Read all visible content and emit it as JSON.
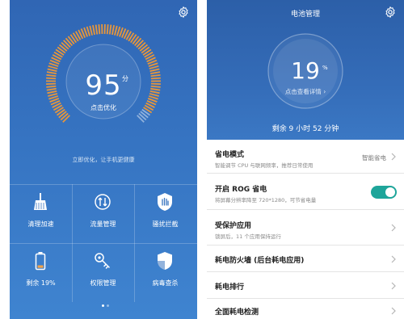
{
  "colors": {
    "left_bg_top": "#3066b4",
    "gauge_orange": "#e8963a",
    "right_bg": "#2c5fa8",
    "toggle_on": "#1ea59a"
  },
  "optimizer": {
    "settings_icon": "gear-icon",
    "score": "95",
    "score_unit": "分",
    "score_action": "点击优化",
    "score_fraction": 0.95,
    "tip": "立即优化，让手机更健康",
    "tools": [
      {
        "icon": "broom-icon",
        "label": "清理加速"
      },
      {
        "icon": "traffic-icon",
        "label": "流量管理"
      },
      {
        "icon": "hand-block-icon",
        "label": "骚扰拦截"
      },
      {
        "icon": "battery-icon",
        "label": "剩余 19%"
      },
      {
        "icon": "key-icon",
        "label": "权限管理"
      },
      {
        "icon": "shield-icon",
        "label": "病毒查杀"
      }
    ],
    "page_count": 2,
    "active_page": 1
  },
  "battery": {
    "title": "电池管理",
    "settings_icon": "gear-icon",
    "percent": "19",
    "percent_unit": "%",
    "percent_fraction": 0.19,
    "detail": "点击查看详情",
    "remaining": "剩余 9 小时 52 分钟",
    "rows": [
      {
        "title": "省电模式",
        "subtitle": "智能调节 CPU 与联网频率，推荐日常使用",
        "value": "智能省电",
        "control": "chevron"
      },
      {
        "title": "开启 ROG 省电",
        "subtitle": "将屏幕分辨率降至 720*1280，可节省电量",
        "value": "",
        "control": "toggle-on"
      },
      {
        "title": "受保护应用",
        "subtitle": "锁屏后，11 个应用保持运行",
        "value": "",
        "control": "chevron"
      },
      {
        "title": "耗电防火墙 (后台耗电应用)",
        "subtitle": "",
        "value": "",
        "control": "chevron"
      },
      {
        "title": "耗电排行",
        "subtitle": "",
        "value": "",
        "control": "chevron"
      },
      {
        "title": "全面耗电检测",
        "subtitle": "",
        "value": "",
        "control": "chevron"
      }
    ]
  }
}
